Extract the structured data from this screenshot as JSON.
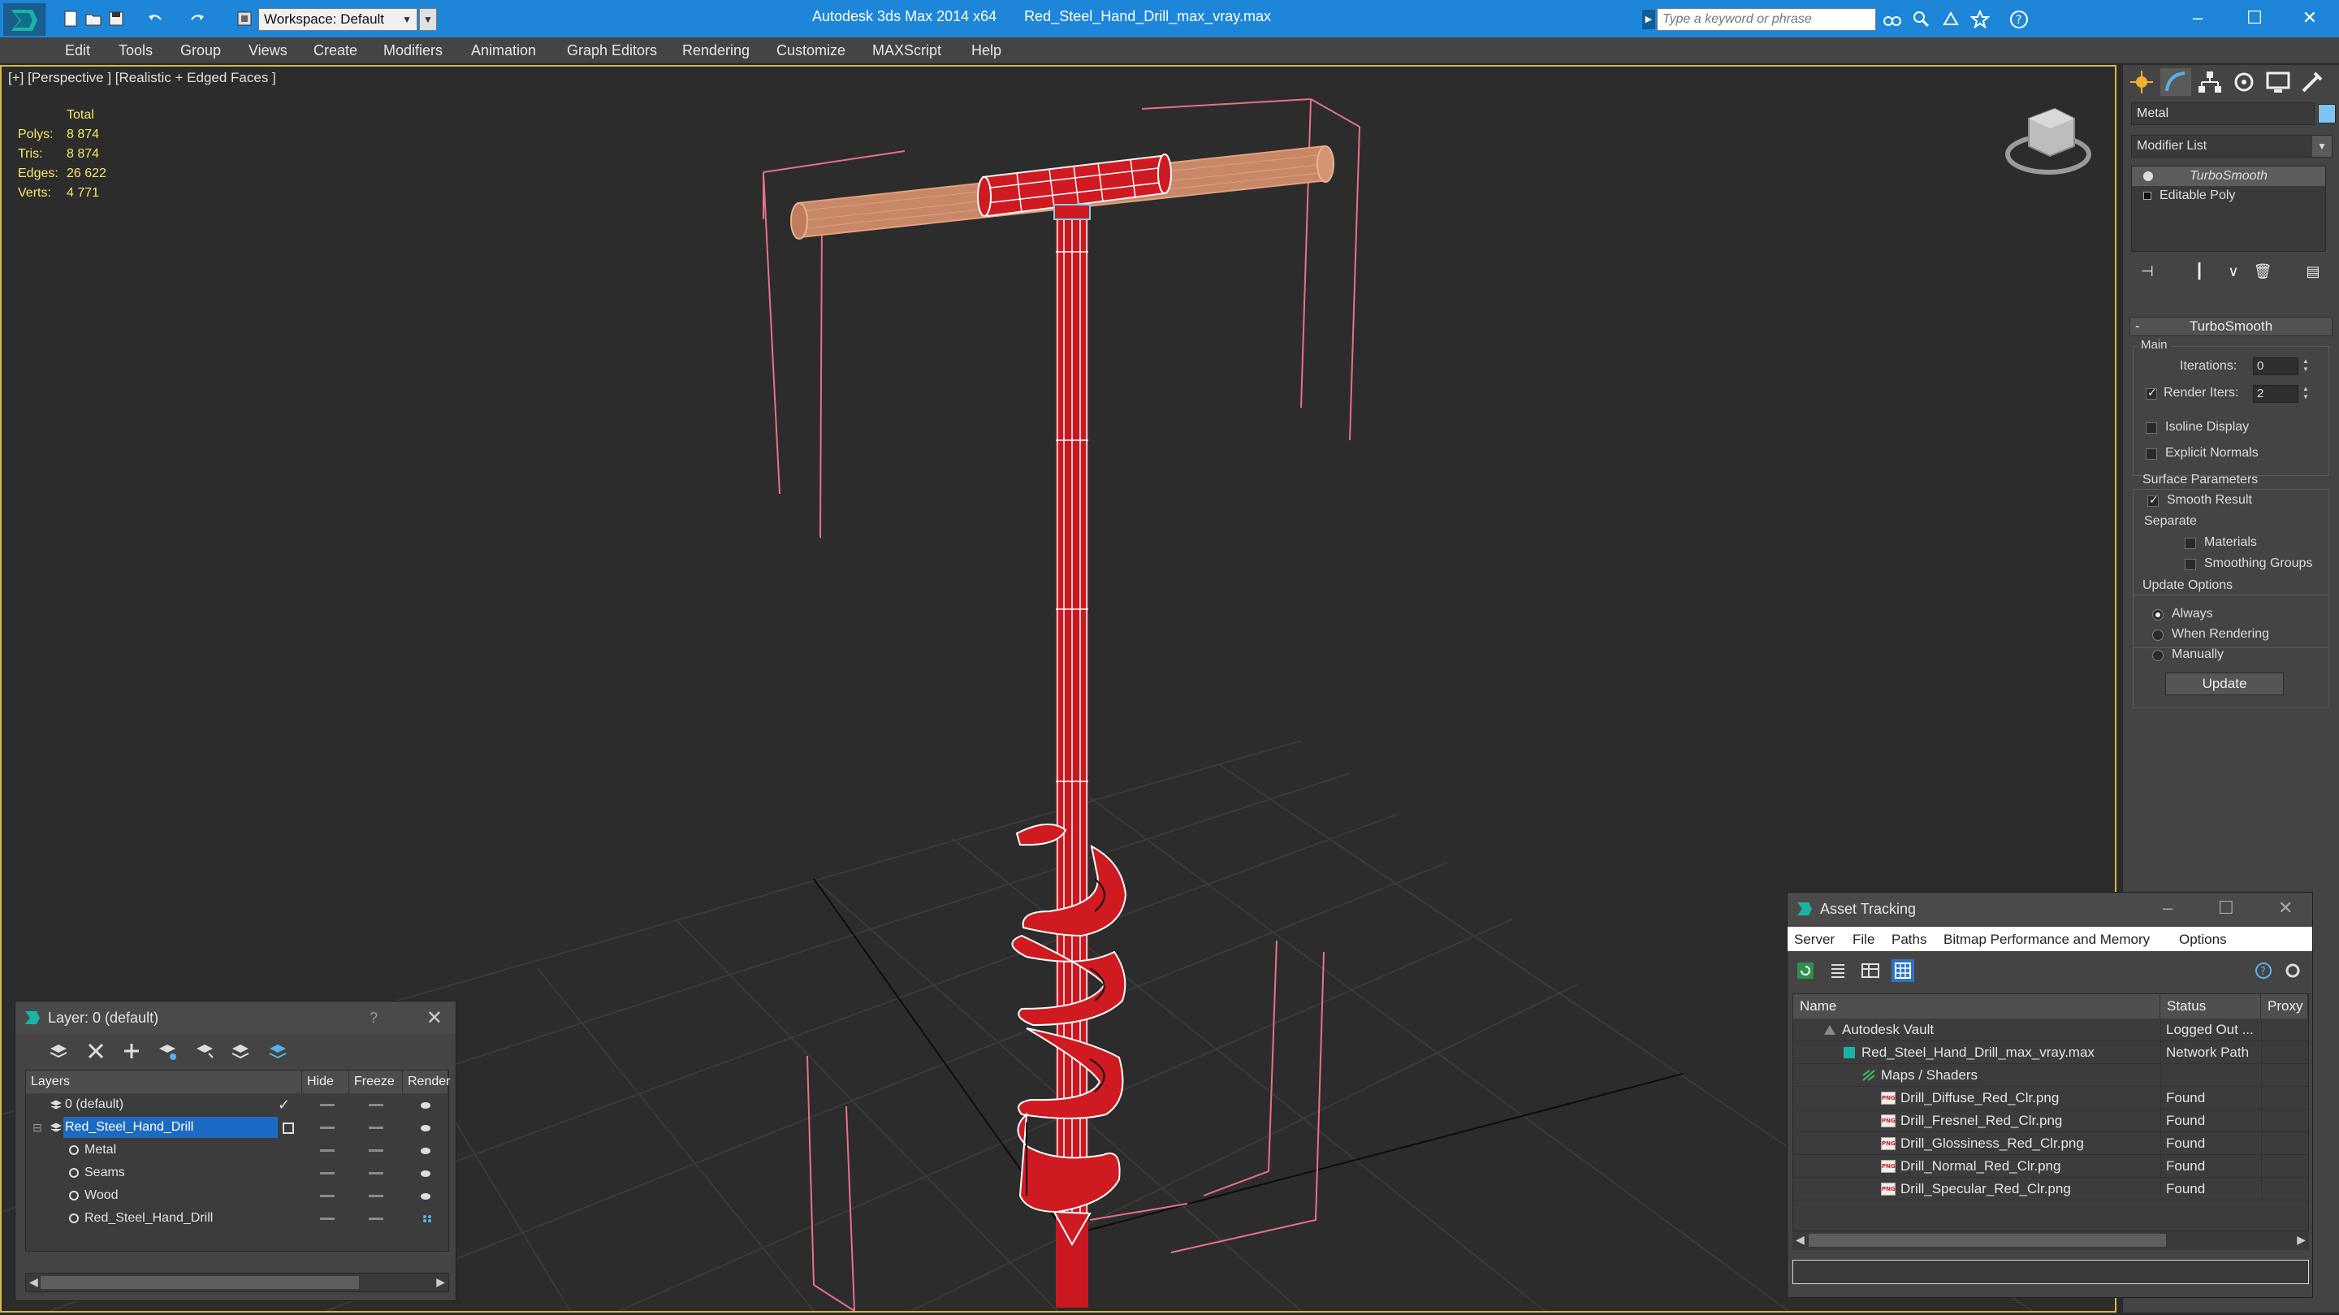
{
  "title_bar": {
    "workspace": "Workspace: Default",
    "app_title": "Autodesk 3ds Max  2014 x64",
    "file_title": "Red_Steel_Hand_Drill_max_vray.max",
    "search_placeholder": "Type a keyword or phrase",
    "minimize": "–",
    "maximize": "☐",
    "close": "✕"
  },
  "menu": [
    "Edit",
    "Tools",
    "Group",
    "Views",
    "Create",
    "Modifiers",
    "Animation",
    "Graph Editors",
    "Rendering",
    "Customize",
    "MAXScript",
    "Help"
  ],
  "viewport": {
    "label": "[+] [Perspective ] [Realistic + Edged Faces ]",
    "stats_header": "Total",
    "stats": [
      {
        "k": "Polys:",
        "v": "8 874"
      },
      {
        "k": "Tris:",
        "v": "8 874"
      },
      {
        "k": "Edges:",
        "v": "26 622"
      },
      {
        "k": "Verts:",
        "v": "4 771"
      }
    ]
  },
  "command_panel": {
    "object_name": "Metal",
    "object_color": "#7fc3f0",
    "modifier_list": "Modifier List",
    "stack": [
      "TurboSmooth",
      "Editable Poly"
    ],
    "rollout_title": "TurboSmooth",
    "main_group": "Main",
    "iterations_label": "Iterations:",
    "iterations_value": "0",
    "render_iters_label": "Render Iters:",
    "render_iters_value": "2",
    "isoline_display": "Isoline Display",
    "explicit_normals": "Explicit Normals",
    "surface_params": "Surface Parameters",
    "smooth_result": "Smooth Result",
    "separate": "Separate",
    "materials": "Materials",
    "smoothing_groups": "Smoothing Groups",
    "update_options": "Update Options",
    "always": "Always",
    "when_rendering": "When Rendering",
    "manually": "Manually",
    "update_button": "Update"
  },
  "layer_dialog": {
    "title": "Layer: 0 (default)",
    "help": "?",
    "close": "✕",
    "columns": [
      "Layers",
      "Hide",
      "Freeze",
      "Render"
    ],
    "rows": [
      {
        "name": "0 (default)",
        "level": 0
      },
      {
        "name": "Red_Steel_Hand_Drill",
        "level": 0
      },
      {
        "name": "Metal",
        "level": 1
      },
      {
        "name": "Seams",
        "level": 1
      },
      {
        "name": "Wood",
        "level": 1
      },
      {
        "name": "Red_Steel_Hand_Drill",
        "level": 1
      }
    ]
  },
  "asset_dialog": {
    "title": "Asset Tracking",
    "menu": [
      "Server",
      "File",
      "Paths",
      "Bitmap Performance and Memory",
      "Options"
    ],
    "columns": [
      "Name",
      "Status",
      "Proxy"
    ],
    "rows": [
      {
        "name": "Autodesk Vault",
        "status": "Logged Out ...",
        "level": 0,
        "icon": "vault"
      },
      {
        "name": "Red_Steel_Hand_Drill_max_vray.max",
        "status": "Network Path",
        "level": 1,
        "icon": "max"
      },
      {
        "name": "Maps / Shaders",
        "status": "",
        "level": 2,
        "icon": "maps"
      },
      {
        "name": "Drill_Diffuse_Red_Clr.png",
        "status": "Found",
        "level": 3,
        "icon": "png"
      },
      {
        "name": "Drill_Fresnel_Red_Clr.png",
        "status": "Found",
        "level": 3,
        "icon": "png"
      },
      {
        "name": "Drill_Glossiness_Red_Clr.png",
        "status": "Found",
        "level": 3,
        "icon": "png"
      },
      {
        "name": "Drill_Normal_Red_Clr.png",
        "status": "Found",
        "level": 3,
        "icon": "png"
      },
      {
        "name": "Drill_Specular_Red_Clr.png",
        "status": "Found",
        "level": 3,
        "icon": "png"
      }
    ],
    "png_label": "PNG"
  }
}
